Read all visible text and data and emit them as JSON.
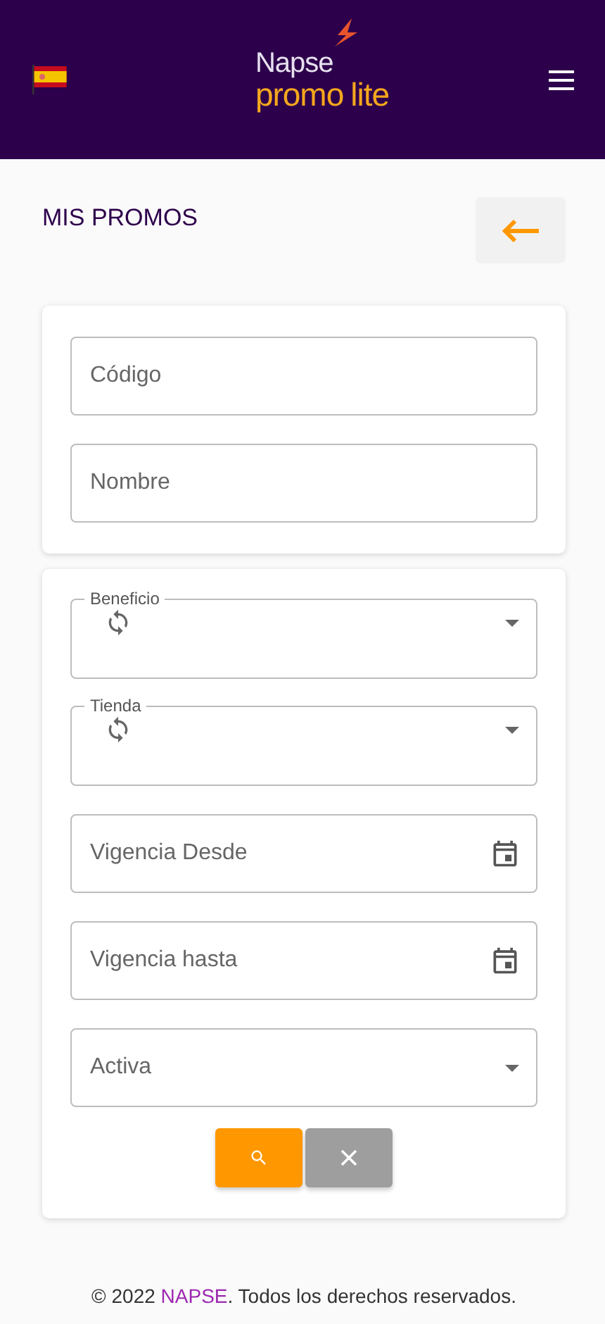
{
  "header": {
    "logo": {
      "top": "Napse",
      "bottom_left": "promo",
      "bottom_right": "lite"
    }
  },
  "page": {
    "title": "MIS PROMOS"
  },
  "filters": [
    {
      "kind": "text",
      "placeholder": "Código"
    },
    {
      "kind": "text",
      "placeholder": "Nombre"
    }
  ],
  "advanced_filters": [
    {
      "kind": "select",
      "label": "Beneficio",
      "loading": true
    },
    {
      "kind": "select",
      "label": "Tienda",
      "loading": true
    },
    {
      "kind": "date",
      "placeholder": "Vigencia Desde"
    },
    {
      "kind": "date",
      "placeholder": "Vigencia hasta"
    },
    {
      "kind": "select",
      "placeholder": "Activa",
      "loading": false
    }
  ],
  "footer": {
    "prefix": "© 2022 ",
    "link": "NAPSE",
    "suffix": ". Todos los derechos reservados."
  }
}
